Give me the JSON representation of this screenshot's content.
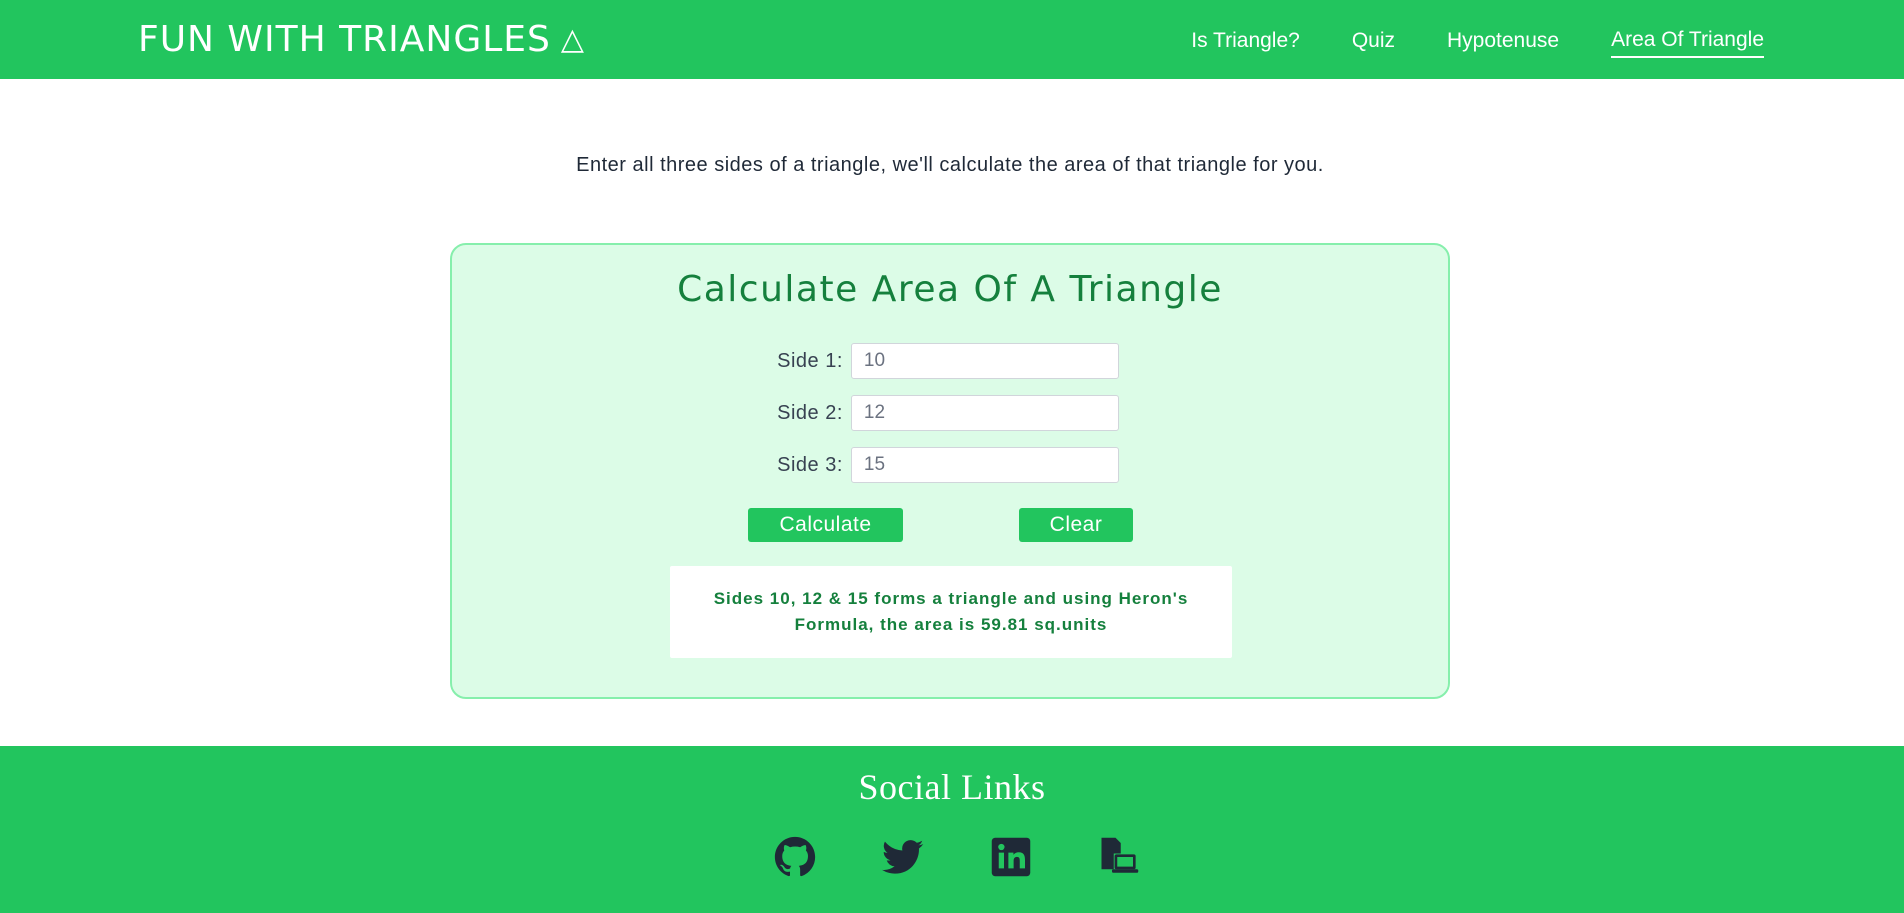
{
  "navbar": {
    "brand": "FUN WITH TRIANGLES",
    "brand_icon": "△",
    "links": [
      {
        "label": "Is Triangle?",
        "active": false
      },
      {
        "label": "Quiz",
        "active": false
      },
      {
        "label": "Hypotenuse",
        "active": false
      },
      {
        "label": "Area Of Triangle",
        "active": true
      }
    ]
  },
  "intro": {
    "text": "Enter all three sides of a triangle, we'll calculate the area of that triangle for you."
  },
  "calculator": {
    "title": "Calculate Area Of A Triangle",
    "fields": [
      {
        "label": "Side 1:",
        "value": "10"
      },
      {
        "label": "Side 2:",
        "value": "12"
      },
      {
        "label": "Side 3:",
        "value": "15"
      }
    ],
    "calculate_label": "Calculate",
    "clear_label": "Clear",
    "result": "Sides 10, 12 & 15 forms a triangle and using Heron's Formula, the area is 59.81 sq.units"
  },
  "footer": {
    "title": "Social Links",
    "icons": [
      "github-icon",
      "twitter-icon",
      "linkedin-icon",
      "portfolio-icon"
    ]
  },
  "colors": {
    "brand_green": "#22c55e",
    "card_bg": "#dcfce7",
    "card_border": "#86efac",
    "title_green": "#15803d",
    "icon_dark": "#1f2937"
  }
}
